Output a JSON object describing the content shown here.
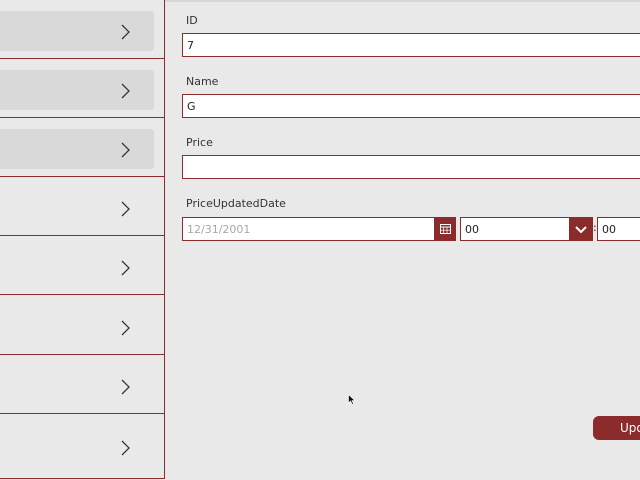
{
  "colors": {
    "accent": "#8c2b2b",
    "background": "#e9e9e9",
    "selected_row": "#d9d9d9"
  },
  "gallery": {
    "items": [
      {
        "selected": true,
        "icon": "chevron-right-icon"
      },
      {
        "selected": true,
        "icon": "chevron-right-icon"
      },
      {
        "selected": true,
        "icon": "chevron-right-icon"
      },
      {
        "selected": false,
        "icon": "chevron-right-icon"
      },
      {
        "selected": false,
        "icon": "chevron-right-icon"
      },
      {
        "selected": false,
        "icon": "chevron-right-icon"
      },
      {
        "selected": false,
        "icon": "chevron-right-icon"
      },
      {
        "selected": false,
        "icon": "chevron-right-icon"
      }
    ]
  },
  "form": {
    "id_label": "ID",
    "id_value": "7",
    "name_label": "Name",
    "name_value": "G",
    "price_label": "Price",
    "price_value": "",
    "date_label": "PriceUpdatedDate",
    "date_placeholder": "12/31/2001",
    "hour_value": "00",
    "time_separator": ":",
    "minute_value": "00"
  },
  "actions": {
    "update_label": "Update"
  }
}
